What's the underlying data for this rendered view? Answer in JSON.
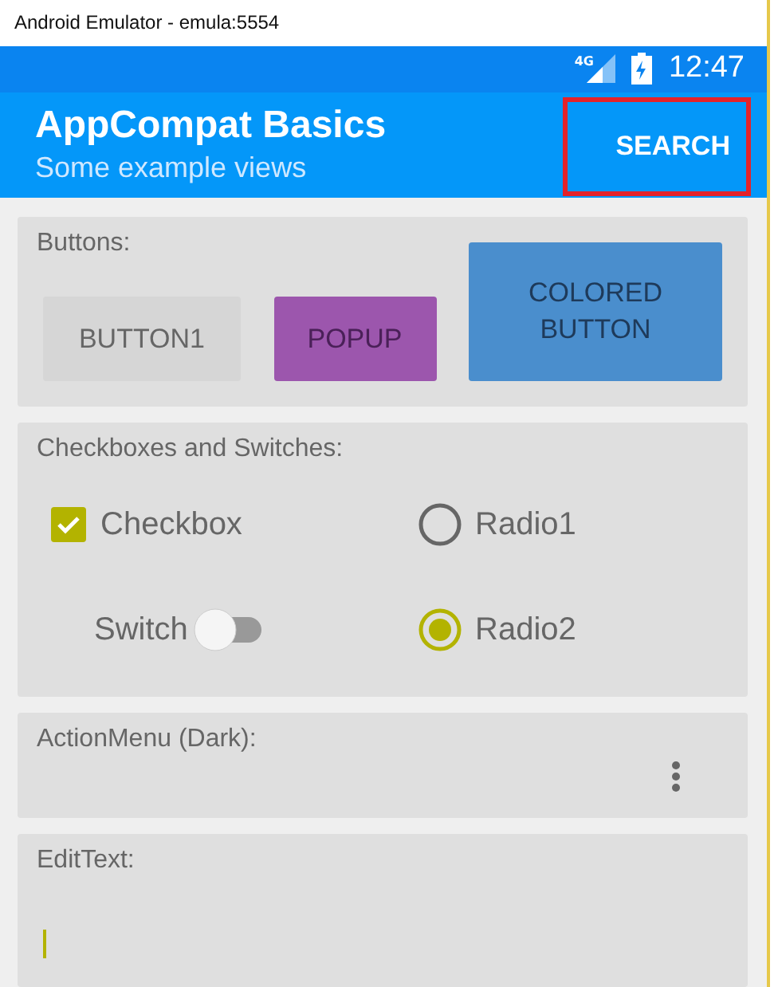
{
  "window": {
    "title": "Android Emulator - emula:5554"
  },
  "status_bar": {
    "network": "4G",
    "time": "12:47"
  },
  "app_bar": {
    "title": "AppCompat Basics",
    "subtitle": "Some example views",
    "action": "SEARCH",
    "action_highlighted": true
  },
  "buttons_card": {
    "heading": "Buttons:",
    "buttons": [
      {
        "label": "BUTTON1",
        "kind": "plain"
      },
      {
        "label": "POPUP",
        "kind": "purple"
      },
      {
        "label": "COLORED BUTTON",
        "kind": "colored"
      }
    ]
  },
  "checks_card": {
    "heading": "Checkboxes and Switches:",
    "controls": [
      {
        "kind": "checkbox",
        "label": "Checkbox",
        "checked": true
      },
      {
        "kind": "radio",
        "label": "Radio1",
        "selected": false
      },
      {
        "kind": "switch",
        "label": "Switch",
        "on": false
      },
      {
        "kind": "radio",
        "label": "Radio2",
        "selected": true
      }
    ]
  },
  "action_menu_card": {
    "heading": "ActionMenu (Dark):"
  },
  "edit_text_card": {
    "heading": "EditText:",
    "focused": true
  }
}
